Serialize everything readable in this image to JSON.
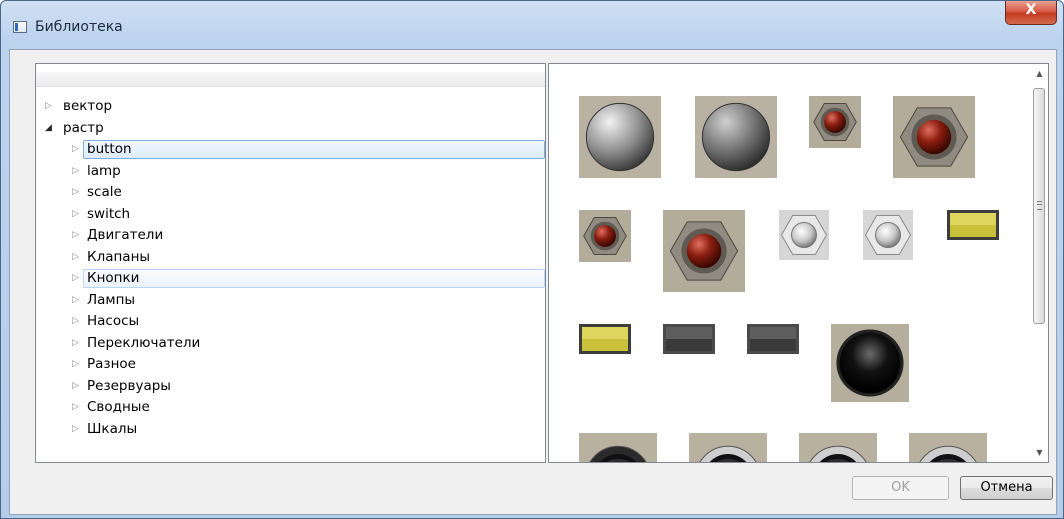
{
  "window": {
    "title": "Библиотека",
    "close_glyph": "X"
  },
  "tree": {
    "items": [
      {
        "label": "вектор",
        "level": 0,
        "expanded": false
      },
      {
        "label": "растр",
        "level": 0,
        "expanded": true
      },
      {
        "label": "button",
        "level": 1,
        "expanded": false,
        "state": "selected"
      },
      {
        "label": "lamp",
        "level": 1,
        "expanded": false
      },
      {
        "label": "scale",
        "level": 1,
        "expanded": false
      },
      {
        "label": "switch",
        "level": 1,
        "expanded": false
      },
      {
        "label": "Двигатели",
        "level": 1,
        "expanded": false
      },
      {
        "label": "Клапаны",
        "level": 1,
        "expanded": false
      },
      {
        "label": "Кнопки",
        "level": 1,
        "expanded": false,
        "state": "hovered"
      },
      {
        "label": "Лампы",
        "level": 1,
        "expanded": false
      },
      {
        "label": "Насосы",
        "level": 1,
        "expanded": false
      },
      {
        "label": "Переключатели",
        "level": 1,
        "expanded": false
      },
      {
        "label": "Разное",
        "level": 1,
        "expanded": false
      },
      {
        "label": "Резервуары",
        "level": 1,
        "expanded": false
      },
      {
        "label": "Сводные",
        "level": 1,
        "expanded": false
      },
      {
        "label": "Шкалы",
        "level": 1,
        "expanded": false
      }
    ]
  },
  "gallery": {
    "images": [
      {
        "name": "grey-dome-button-light"
      },
      {
        "name": "grey-dome-button-dark"
      },
      {
        "name": "red-hex-button-small"
      },
      {
        "name": "red-hex-button-large"
      },
      {
        "name": "red-hex-button-small-2"
      },
      {
        "name": "red-hex-button-large-2"
      },
      {
        "name": "white-hex-button"
      },
      {
        "name": "white-hex-button-2"
      },
      {
        "name": "yellow-rect-lamp"
      },
      {
        "name": "yellow-rect-lamp-2"
      },
      {
        "name": "grey-rect-lamp"
      },
      {
        "name": "grey-rect-lamp-2"
      },
      {
        "name": "black-dome-button"
      },
      {
        "name": "black-ring-button"
      },
      {
        "name": "silver-ring-button"
      },
      {
        "name": "silver-ring-button-2"
      },
      {
        "name": "silver-ring-button-3"
      }
    ]
  },
  "buttons": {
    "ok": "OK",
    "cancel": "Отмена",
    "ok_enabled": false
  },
  "colors": {
    "selection_border": "#84acdd",
    "hover_border": "#b8d6fb",
    "titlebar": "#bcd3ee"
  }
}
